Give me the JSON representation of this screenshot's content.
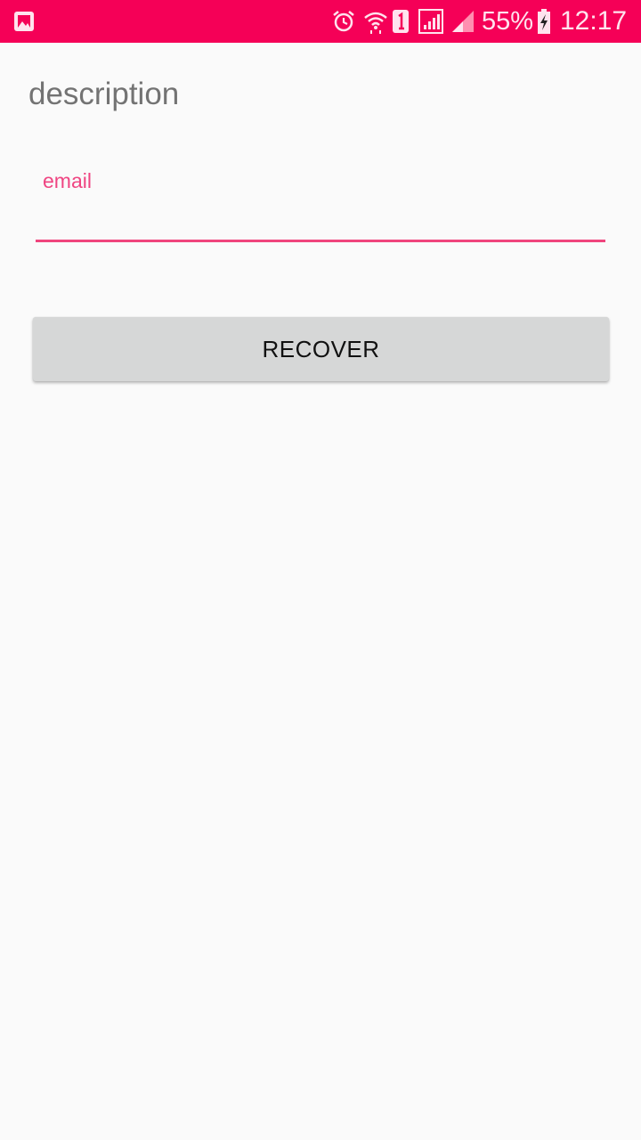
{
  "status_bar": {
    "background_color": "#f50057",
    "left_icon": "gallery-notification-icon",
    "icons": [
      "alarm-icon",
      "wifi-icon",
      "sim-1-icon",
      "signal-box-icon",
      "signal-icon",
      "battery-charging-icon"
    ],
    "battery_percent": "55%",
    "time": "12:17"
  },
  "form": {
    "description": "description",
    "email_label": "email",
    "email_value": "",
    "recover_button_label": "RECOVER",
    "accent_color": "#f0457d"
  }
}
